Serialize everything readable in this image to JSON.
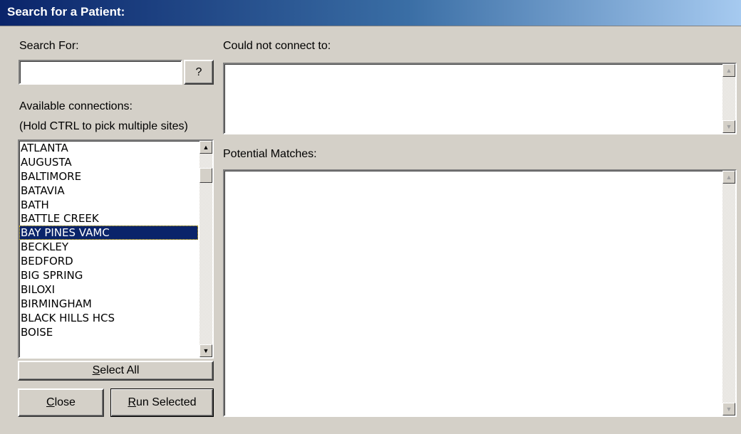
{
  "window": {
    "title": "Search for a Patient:"
  },
  "search": {
    "label": "Search For:",
    "value": "",
    "help_button": "?"
  },
  "connections": {
    "label": "Available connections:",
    "hint": "(Hold CTRL to pick multiple sites)",
    "items": [
      "ATLANTA",
      "AUGUSTA",
      "BALTIMORE",
      "BATAVIA",
      "BATH",
      "BATTLE CREEK",
      "BAY PINES VAMC",
      "BECKLEY",
      "BEDFORD",
      "BIG SPRING",
      "BILOXI",
      "BIRMINGHAM",
      "BLACK HILLS HCS",
      "BOISE"
    ],
    "selected": "BAY PINES VAMC"
  },
  "buttons": {
    "select_all": {
      "mnemonic": "S",
      "rest": "elect All"
    },
    "close": {
      "mnemonic": "C",
      "rest": "lose"
    },
    "run_selected": {
      "mnemonic": "R",
      "rest": "un Selected"
    }
  },
  "could_not_connect": {
    "label": "Could not connect to:"
  },
  "potential_matches": {
    "label": "Potential Matches:"
  },
  "icons": {
    "scroll_up": "arrow-up-icon",
    "scroll_down": "arrow-down-icon"
  }
}
